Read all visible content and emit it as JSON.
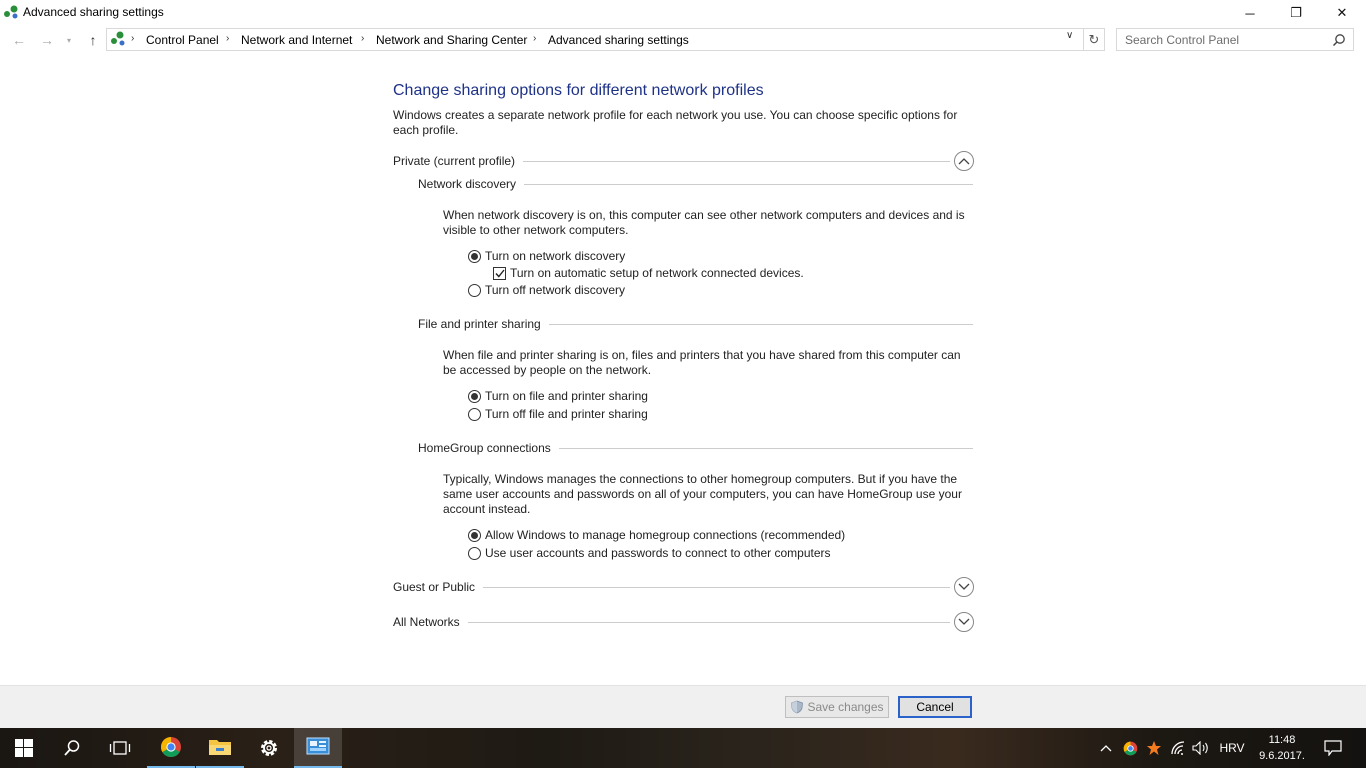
{
  "window": {
    "title": "Advanced sharing settings",
    "minimize_glyph": "─",
    "maximize_glyph": "❐",
    "close_glyph": "✕"
  },
  "nav": {
    "back_glyph": "←",
    "forward_glyph": "→",
    "recent_glyph": "▾",
    "up_glyph": "↑",
    "breadcrumbs": [
      "Control Panel",
      "Network and Internet",
      "Network and Sharing Center",
      "Advanced sharing settings"
    ],
    "separator": "›",
    "dropdown_glyph": "∨",
    "refresh_glyph": "↻",
    "search_placeholder": "Search Control Panel"
  },
  "main": {
    "heading": "Change sharing options for different network profiles",
    "intro": "Windows creates a separate network profile for each network you use. You can choose specific options for each profile.",
    "profiles": {
      "private": {
        "label": "Private (current profile)",
        "expanded": true,
        "network_discovery": {
          "label": "Network discovery",
          "description": "When network discovery is on, this computer can see other network computers and devices and is visible to other network computers.",
          "opt_on": "Turn on network discovery",
          "opt_auto": "Turn on automatic setup of network connected devices.",
          "opt_off": "Turn off network discovery"
        },
        "file_sharing": {
          "label": "File and printer sharing",
          "description": "When file and printer sharing is on, files and printers that you have shared from this computer can be accessed by people on the network.",
          "opt_on": "Turn on file and printer sharing",
          "opt_off": "Turn off file and printer sharing"
        },
        "homegroup": {
          "label": "HomeGroup connections",
          "description": "Typically, Windows manages the connections to other homegroup computers. But if you have the same user accounts and passwords on all of your computers, you can have HomeGroup use your account instead.",
          "opt_windows": "Allow Windows to manage homegroup connections (recommended)",
          "opt_user": "Use user accounts and passwords to connect to other computers"
        }
      },
      "guest": {
        "label": "Guest or Public",
        "expanded": false
      },
      "all": {
        "label": "All Networks",
        "expanded": false
      }
    }
  },
  "footer": {
    "save_label": "Save changes",
    "cancel_label": "Cancel"
  },
  "taskbar": {
    "language": "HRV",
    "time": "11:48",
    "date": "9.6.2017.",
    "accent_color": "#76b9ed"
  },
  "colors": {
    "heading": "#1e3287",
    "focus_border": "#2a62c9"
  }
}
